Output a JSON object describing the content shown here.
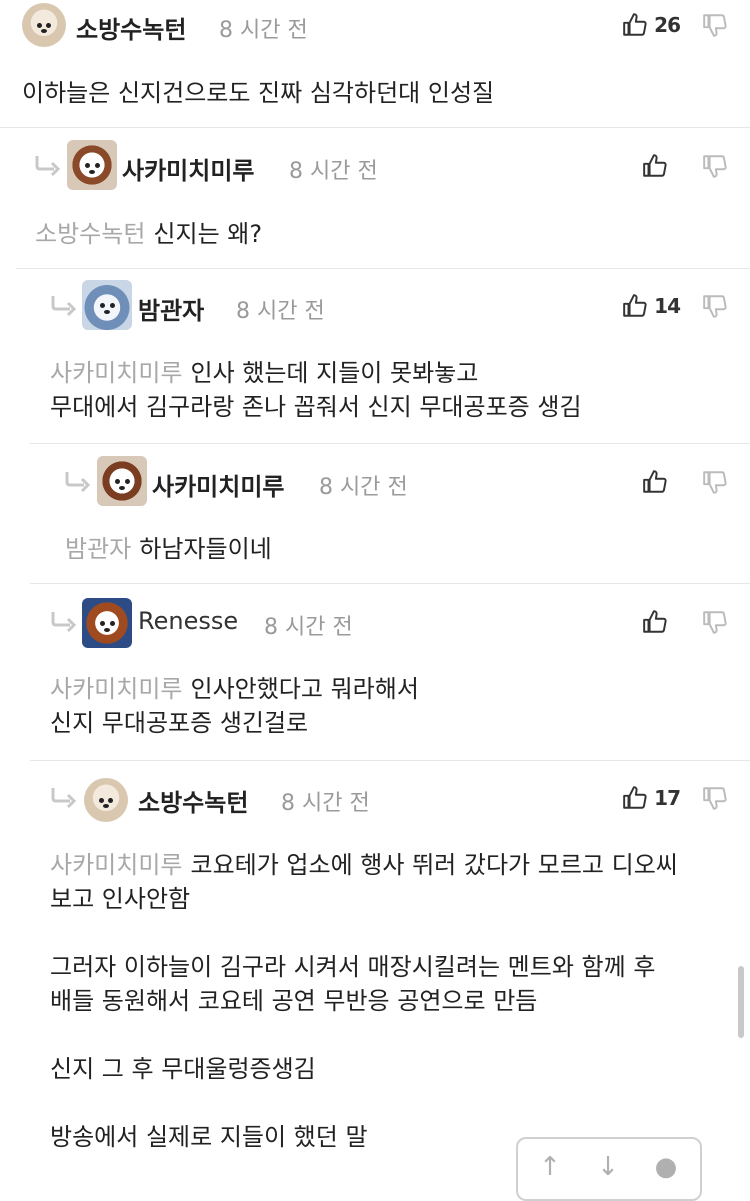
{
  "comments": [
    {
      "author": "소방수녹턴",
      "time": "8 시간 전",
      "likes": "26",
      "mention": "",
      "lines": [
        "이하늘은 신지건으로도 진짜 심각하던대 인성질"
      ]
    },
    {
      "author": "사카미치미루",
      "time": "8 시간 전",
      "likes": "",
      "mention": "소방수녹턴",
      "lines": [
        "신지는 왜?"
      ]
    },
    {
      "author": "밤관자",
      "time": "8 시간 전",
      "likes": "14",
      "mention": "사카미치미루",
      "lines": [
        "인사 했는데 지들이 못봐놓고",
        "무대에서 김구라랑 존나 꼽줘서 신지 무대공포증 생김"
      ]
    },
    {
      "author": "사카미치미루",
      "time": "8 시간 전",
      "likes": "",
      "mention": "밤관자",
      "lines": [
        "하남자들이네"
      ]
    },
    {
      "author": "Renesse",
      "time": "8 시간 전",
      "likes": "",
      "mention": "사카미치미루",
      "lines": [
        "인사안했다고 뭐라해서",
        "신지 무대공포증 생긴걸로"
      ]
    },
    {
      "author": "소방수녹턴",
      "time": "8 시간 전",
      "likes": "17",
      "mention": "사카미치미루",
      "lines": [
        "코요테가 업소에 행사 뛰러 갔다가 모르고 디오씨",
        "보고 인사안함",
        "그러자 이하늘이 김구라 시켜서 매장시킬려는 멘트와 함께 후",
        "배들 동원해서 코요테 공연 무반응 공연으로 만듬",
        "신지 그 후 무대울렁증생김",
        "방송에서 실제로 지들이 했던 말"
      ]
    }
  ],
  "icons": {
    "like": "thumbs-up-icon",
    "dislike": "thumbs-down-icon",
    "reply": "reply-arrow-icon",
    "up": "arrow-up-icon",
    "down": "arrow-down-icon",
    "comment": "comment-bubble-icon"
  },
  "colors": {
    "text": "#222222",
    "muted": "#9a9a9a",
    "mention": "#a8a8a8",
    "divider": "#e6e6e6"
  }
}
